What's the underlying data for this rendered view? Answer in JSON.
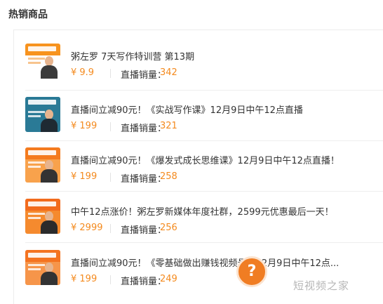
{
  "section": {
    "title": "热销商品"
  },
  "products": [
    {
      "title": "粥左罗 7天写作特训营 第13期",
      "price": "¥ 9.9",
      "sales_label": "直播销量：",
      "sales_value": "342",
      "thumb": {
        "band": "#f7931e",
        "bg": "#ffffff",
        "person_body": "#3a3a3a"
      }
    },
    {
      "title": "直播间立减90元！《实战写作课》12月9日中午12点直播",
      "price": "¥ 199",
      "sales_label": "直播销量：",
      "sales_value": "321",
      "thumb": {
        "band": "#2a7a96",
        "bg": "#2a7a96",
        "person_body": "#1f2a33"
      }
    },
    {
      "title": "直播间立减90元！《爆发式成长思维课》12月9日中午12点直播！",
      "price": "¥ 199",
      "sales_label": "直播销量：",
      "sales_value": "258",
      "thumb": {
        "band": "#f47b1f",
        "bg": "#f8a24c",
        "person_body": "#333333"
      }
    },
    {
      "title": "中午12点涨价！粥左罗新媒体年度社群，2599元优惠最后一天！",
      "price": "¥ 2999",
      "sales_label": "直播销量：",
      "sales_value": "256",
      "thumb": {
        "band": "#f26b1d",
        "bg": "#f58a2e",
        "person_body": "#2b2b2b"
      }
    },
    {
      "title": "直播间立减90元！《零基础做出赚钱视频号》12月9日中午12点...",
      "price": "¥ 199",
      "sales_label": "直播销量：",
      "sales_value": "249",
      "thumb": {
        "band": "#f47320",
        "bg": "#f6954a",
        "person_body": "#333333"
      }
    }
  ],
  "help_badge": {
    "label": "?"
  },
  "watermark": {
    "text": "短视频之家"
  },
  "colors": {
    "accent": "#f48a1e",
    "text": "#333333",
    "divider": "#eeeeee"
  }
}
